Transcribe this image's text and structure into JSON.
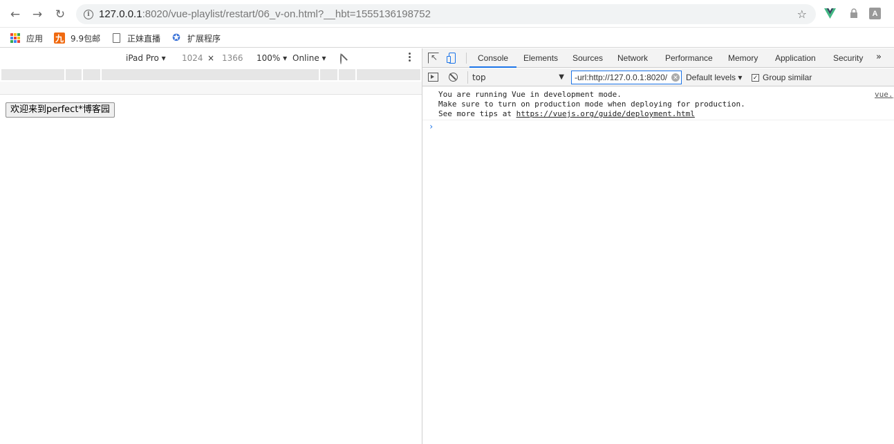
{
  "browser": {
    "url_host": "127.0.0.1",
    "url_path": ":8020/vue-playlist/restart/06_v-on.html?__hbt=1555136198752",
    "ext_a_label": "A"
  },
  "bookmarks": [
    {
      "label": "应用",
      "icon": "apps-grid-icon"
    },
    {
      "label": "9.9包邮",
      "icon": "nine-icon",
      "icon_text": "九"
    },
    {
      "label": "正妹直播",
      "icon": "page-icon"
    },
    {
      "label": "扩展程序",
      "icon": "puzzle-icon"
    }
  ],
  "device_toolbar": {
    "device": "iPad Pro",
    "width": "1024",
    "times": "×",
    "height": "1366",
    "zoom": "100%",
    "network": "Online"
  },
  "page": {
    "button_label": "欢迎来到perfect*博客园"
  },
  "devtools": {
    "tabs": [
      "Console",
      "Elements",
      "Sources",
      "Network",
      "Performance",
      "Memory",
      "Application",
      "Security"
    ],
    "active_tab": "Console",
    "more_tabs": "»",
    "context": "top",
    "filter_value": "-url:http://127.0.0.1:8020/",
    "levels": "Default levels",
    "group_similar": "Group similar",
    "group_similar_checked": true
  },
  "console": {
    "line1": "You are running Vue in development mode.",
    "line2": "Make sure to turn on production mode when deploying for production.",
    "line3_prefix": "See more tips at ",
    "line3_link": "https://vuejs.org/guide/deployment.html",
    "source": "vue.js",
    "prompt": "›"
  },
  "colors": {
    "accent": "#1a73e8",
    "vue_green": "#41b883",
    "vue_dark": "#35495e"
  }
}
